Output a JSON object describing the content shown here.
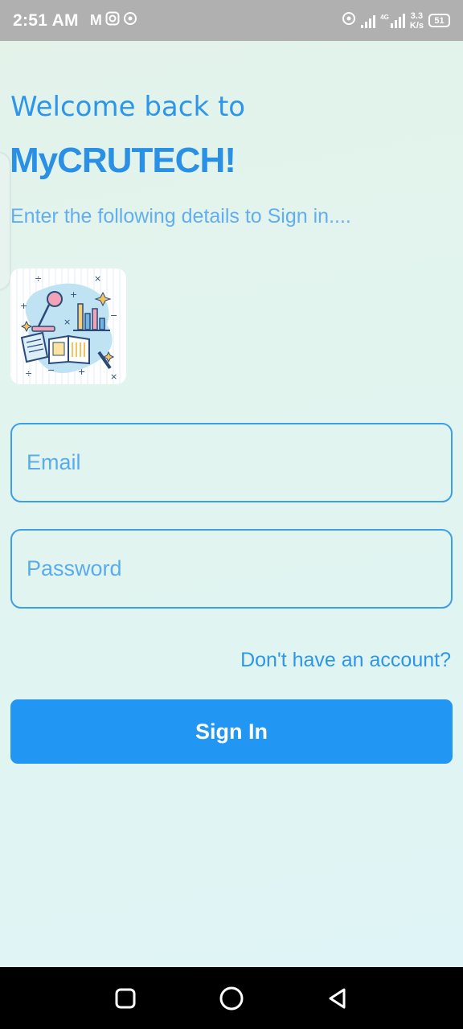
{
  "status_bar": {
    "time": "2:51 AM",
    "left_icons": [
      "gmail-icon",
      "instagram-icon",
      "hotspot-icon"
    ],
    "network": "4G",
    "speed_value": "3.3",
    "speed_unit": "K/s",
    "battery": "51"
  },
  "header": {
    "welcome": "Welcome back to",
    "brand": "MyCRUTECH!",
    "subtitle": "Enter the following details to Sign in...."
  },
  "form": {
    "email_placeholder": "Email",
    "email_value": "",
    "password_placeholder": "Password",
    "password_value": "",
    "signup_link": "Don't have an account?",
    "signin_button": "Sign In"
  },
  "colors": {
    "accent": "#2196f3",
    "heading": "#2e96e8",
    "subtitle": "#63aef0",
    "status_bar": "#b0b0b0"
  }
}
